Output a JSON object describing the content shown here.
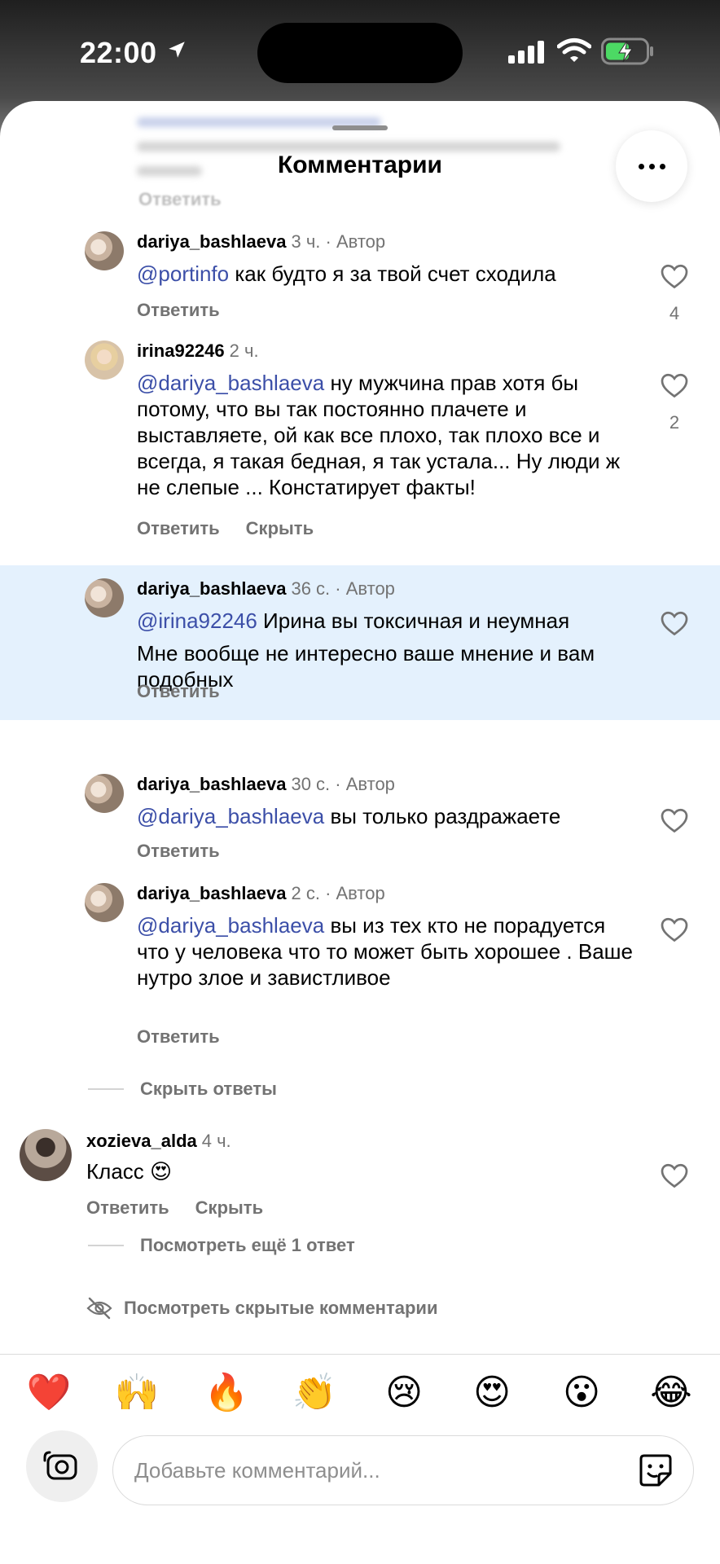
{
  "status_bar": {
    "time": "22:00"
  },
  "header": {
    "title": "Комментарии",
    "faded_reply": "Ответить"
  },
  "comments": [
    {
      "username": "dariya_bashlaeva",
      "time": "3 ч.",
      "author_label": "· Автор",
      "mention": "@portinfo",
      "text": " как будто я за твой счет сходила",
      "actions": [
        "Ответить"
      ],
      "likes": "4"
    },
    {
      "username": "irina92246",
      "time": "2 ч.",
      "author_label": "",
      "mention": "@dariya_bashlaeva",
      "text": " ну мужчина прав хотя бы потому, что вы так постоянно плачете и выставляете, ой как все плохо, так плохо все и всегда, я такая бедная, я так устала... Ну люди ж не слепые ... Констатирует факты!",
      "actions": [
        "Ответить",
        "Скрыть"
      ],
      "likes": "2"
    },
    {
      "username": "dariya_bashlaeva",
      "time": "36 с.",
      "author_label": "· Автор",
      "mention": "@irina92246",
      "text": " Ирина вы токсичная и неумная",
      "text2": "Мне вообще не интересно ваше мнение и вам подобных",
      "actions": [
        "Ответить"
      ],
      "likes": ""
    },
    {
      "username": "dariya_bashlaeva",
      "time": "30 с.",
      "author_label": "· Автор",
      "mention": "@dariya_bashlaeva",
      "text": " вы только раздражаете",
      "actions": [
        "Ответить"
      ],
      "likes": ""
    },
    {
      "username": "dariya_bashlaeva",
      "time": "2 с.",
      "author_label": "· Автор",
      "mention": "@dariya_bashlaeva",
      "text": " вы из тех кто не порадуется что у человека что то может быть хорошее . Ваше нутро злое и завистливое",
      "actions": [
        "Ответить"
      ],
      "likes": ""
    },
    {
      "username": "xozieva_alda",
      "time": "4 ч.",
      "author_label": "",
      "mention": "",
      "text": "Класс 😍",
      "actions": [
        "Ответить",
        "Скрыть"
      ],
      "likes": ""
    }
  ],
  "hide_replies": "Скрыть ответы",
  "view_more_replies": "Посмотреть ещё 1 ответ",
  "view_hidden": "Посмотреть скрытые комментарии",
  "reactions": [
    "❤️",
    "🙌",
    "🔥",
    "👏",
    "😢",
    "😍",
    "😮",
    "😂"
  ],
  "composer": {
    "placeholder": "Добавьте комментарий..."
  },
  "colors": {
    "mention": "#3c4fa8",
    "highlight": "#e4f1fd",
    "secondary_text": "#737373"
  }
}
